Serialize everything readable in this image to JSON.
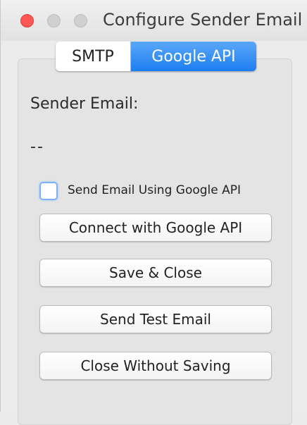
{
  "window": {
    "title": "Configure Sender Email"
  },
  "tabs": [
    {
      "label": "SMTP",
      "selected": false
    },
    {
      "label": "Google API",
      "selected": true
    }
  ],
  "sender": {
    "label": "Sender Email:",
    "value": "--"
  },
  "checkbox": {
    "label": "Send Email Using Google API",
    "checked": false
  },
  "buttons": {
    "connect": "Connect with Google API",
    "save": "Save & Close",
    "test": "Send Test Email",
    "close": "Close Without Saving"
  },
  "colors": {
    "accent": "#1d7ef0",
    "close_light": "#fc5753",
    "window_bg": "#ececec"
  }
}
